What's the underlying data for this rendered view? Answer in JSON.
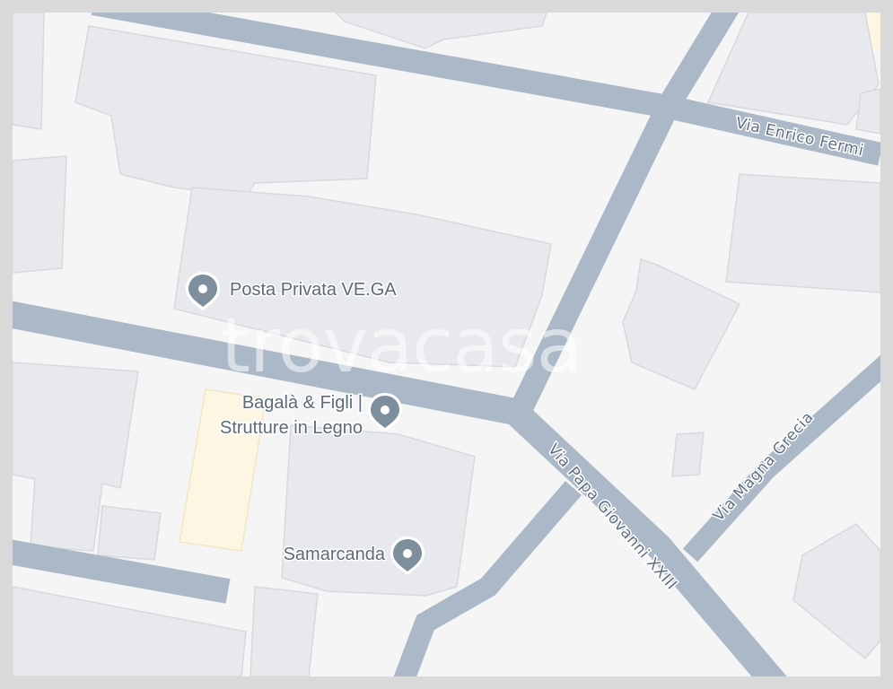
{
  "map": {
    "roads": {
      "via_enrico_fermi": "Via Enrico Fermi",
      "via_papa_giovanni": "Via Papa Giovanni XXIII",
      "via_magna_grecia": "Via Magna Grecia"
    },
    "pois": [
      {
        "name": "Posta Privata VE.GA"
      },
      {
        "name_line1": "Bagalà & Figli |",
        "name_line2": "Strutture in Legno"
      },
      {
        "name": "Samarcanda"
      }
    ],
    "watermark": "trovacasa",
    "colors": {
      "road": "#aab8c7",
      "building": "#e8e9ed",
      "background": "#f5f5f6",
      "pin": "#7d8f9c",
      "highlight_area": "#fdf6e3"
    }
  }
}
